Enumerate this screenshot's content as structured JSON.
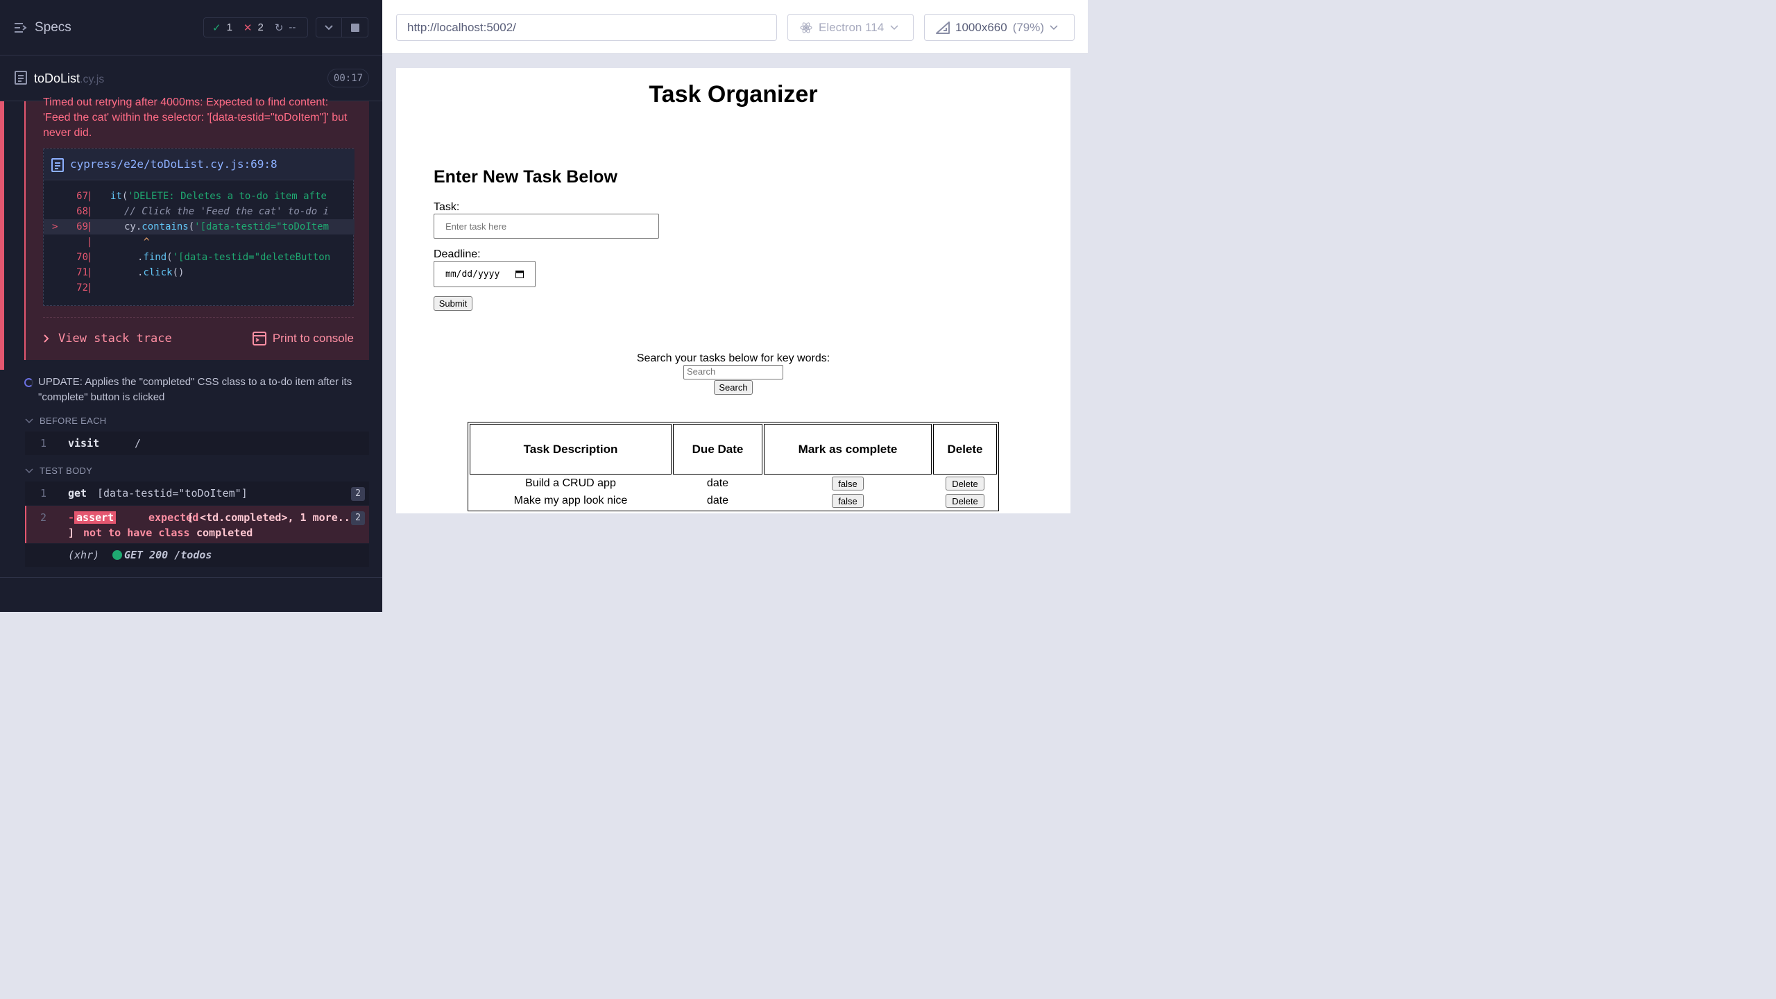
{
  "runner": {
    "specs_label": "Specs",
    "stats": {
      "passed": "1",
      "failed": "2",
      "pending": "--"
    },
    "file": {
      "name": "toDoList",
      "ext": ".cy.js",
      "timer": "00:17"
    },
    "error": {
      "message": "Timed out retrying after 4000ms: Expected to find content: 'Feed the cat' within the selector: '[data-testid=\"toDoItem\"]' but never did.",
      "code_file": "cypress/e2e/toDoList.cy.js:69:8",
      "lines": [
        {
          "num": "67",
          "code": "it('DELETE: Deletes a to-do item afte"
        },
        {
          "num": "68",
          "code": "  // Click the 'Feed the cat' to-do i"
        },
        {
          "num": "69",
          "code": "  cy.contains('[data-testid=\"toDoItem"
        },
        {
          "num": "",
          "code": "      ^"
        },
        {
          "num": "70",
          "code": "    .find('[data-testid=\"deleteButton"
        },
        {
          "num": "71",
          "code": "    .click()"
        },
        {
          "num": "72",
          "code": ""
        }
      ],
      "stack_trace_label": "View stack trace",
      "print_console_label": "Print to console"
    },
    "test": {
      "title": "UPDATE: Applies the \"completed\" CSS class to a to-do item after its \"complete\" button is clicked",
      "before_each_label": "BEFORE EACH",
      "test_body_label": "TEST BODY",
      "commands": [
        {
          "num": "1",
          "name": "visit",
          "message": "/"
        },
        {
          "num": "1",
          "name": "get",
          "message": "[data-testid=\"toDoItem\"]",
          "badge": "2"
        },
        {
          "num": "2",
          "name": "assert",
          "message_a": "expected",
          "message_b": "[ <td.completed>, 1 more...",
          "message_c": "] ",
          "message_d": "not to have class",
          "message_e": "completed",
          "badge": "2"
        }
      ],
      "xhr": {
        "label": "(xhr)",
        "method": "GET",
        "status": "200",
        "path": "/todos"
      }
    }
  },
  "browser": {
    "url": "http://localhost:5002/",
    "browser_name": "Electron 114",
    "viewport": "1000x660",
    "viewport_pct": "(79%)"
  },
  "app": {
    "title": "Task Organizer",
    "form_heading": "Enter New Task Below",
    "task_label": "Task:",
    "task_placeholder": "Enter task here",
    "deadline_label": "Deadline:",
    "date_placeholder": "mm/dd/yyyy",
    "submit_label": "Submit",
    "search_label": "Search your tasks below for key words:",
    "search_placeholder": "Search",
    "search_button": "Search",
    "table": {
      "headers": [
        "Task Description",
        "Due Date",
        "Mark as complete",
        "Delete"
      ],
      "rows": [
        {
          "description": "Build a CRUD app",
          "due": "date",
          "complete": "false",
          "delete": "Delete"
        },
        {
          "description": "Make my app look nice",
          "due": "date",
          "complete": "false",
          "delete": "Delete"
        }
      ]
    }
  },
  "colors": {
    "runner_bg": "#1b1e2e",
    "fail": "#e45770",
    "pass": "#1fa971",
    "link": "#8db0ff"
  }
}
